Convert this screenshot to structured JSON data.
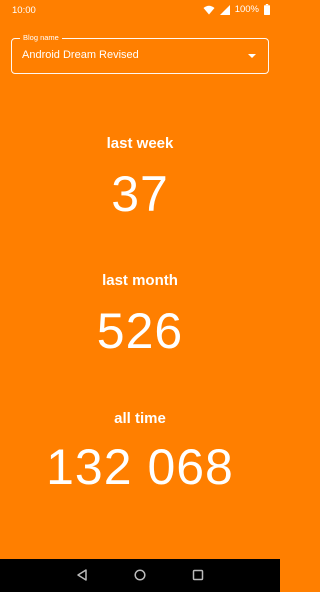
{
  "status": {
    "time": "10:00",
    "battery": "100%",
    "icons": [
      "wifi-icon",
      "signal-icon",
      "battery-icon"
    ]
  },
  "blog_selector": {
    "label": "Blog name",
    "value": "Android Dream Revised"
  },
  "stats": [
    {
      "label": "last week",
      "value": "37"
    },
    {
      "label": "last month",
      "value": "526"
    },
    {
      "label": "all time",
      "value": "132 068"
    }
  ],
  "navigation": {
    "buttons": [
      "back-icon",
      "home-icon",
      "recents-icon"
    ]
  },
  "colors": {
    "background": "#ff7f00",
    "text": "#ffffff",
    "nav_bar": "#000000"
  }
}
